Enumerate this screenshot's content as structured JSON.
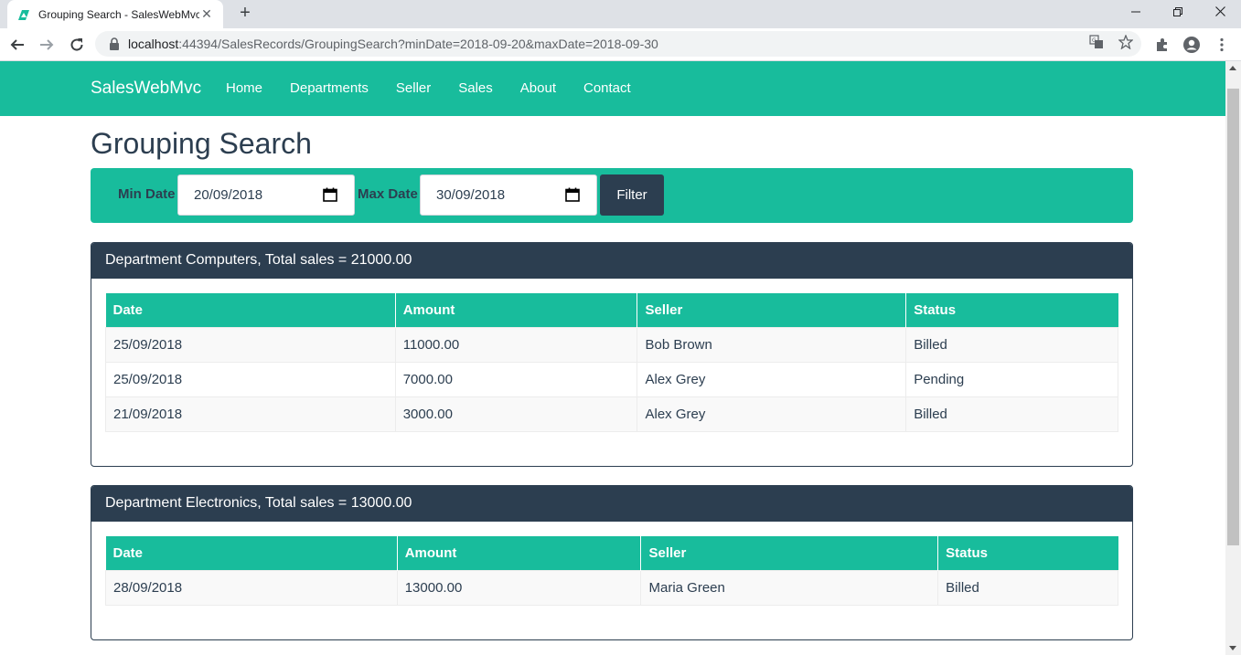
{
  "browser": {
    "tab_title": "Grouping Search - SalesWebMvc",
    "url_host": "localhost",
    "url_path": ":44394/SalesRecords/GroupingSearch?minDate=2018-09-20&maxDate=2018-09-30"
  },
  "navbar": {
    "brand": "SalesWebMvc",
    "links": [
      "Home",
      "Departments",
      "Seller",
      "Sales",
      "About",
      "Contact"
    ]
  },
  "page": {
    "title": "Grouping Search"
  },
  "filter": {
    "min_label": "Min Date",
    "min_value": "20/09/2018",
    "max_label": "Max Date",
    "max_value": "30/09/2018",
    "button": "Filter"
  },
  "columns": [
    "Date",
    "Amount",
    "Seller",
    "Status"
  ],
  "groups": [
    {
      "heading": "Department Computers, Total sales = 21000.00",
      "rows": [
        [
          "25/09/2018",
          "11000.00",
          "Bob Brown",
          "Billed"
        ],
        [
          "25/09/2018",
          "7000.00",
          "Alex Grey",
          "Pending"
        ],
        [
          "21/09/2018",
          "3000.00",
          "Alex Grey",
          "Billed"
        ]
      ]
    },
    {
      "heading": "Department Electronics, Total sales = 13000.00",
      "rows": [
        [
          "28/09/2018",
          "13000.00",
          "Maria Green",
          "Billed"
        ]
      ]
    }
  ],
  "colors": {
    "primary": "#2c3e50",
    "success": "#18bc9c"
  }
}
